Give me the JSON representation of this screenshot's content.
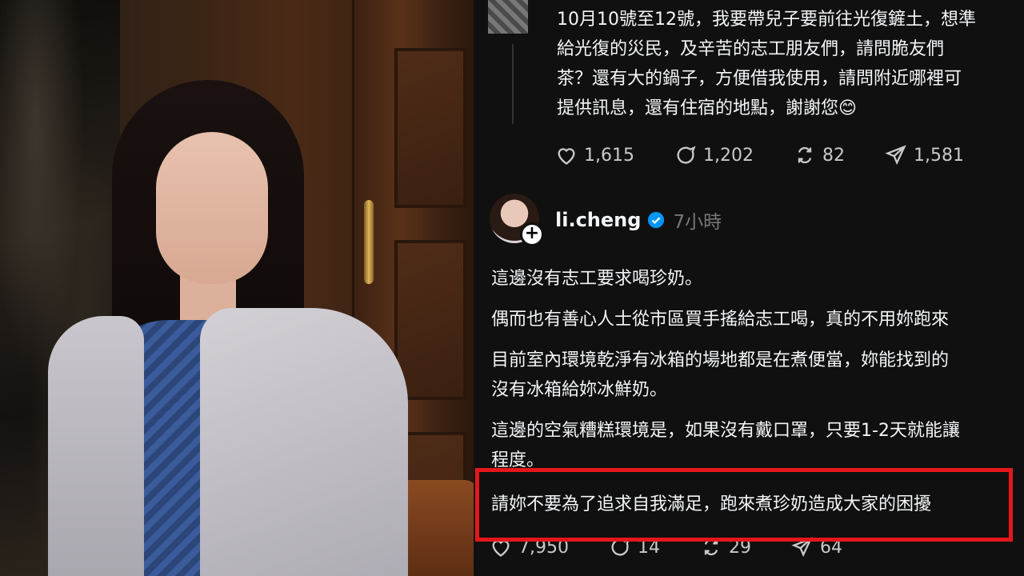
{
  "previous_post": {
    "lines": [
      "10月10號至12號，我要帶兒子要前往光復鏟土，想準",
      "給光復的災民，及辛苦的志工朋友們，請問脆友們",
      "茶？還有大的鍋子，方便借我使用，請問附近哪裡可",
      "提供訊息，還有住宿的地點，謝謝您😊"
    ],
    "stats": {
      "likes": "1,615",
      "comments": "1,202",
      "reposts": "82",
      "shares": "1,581"
    }
  },
  "reply": {
    "username": "li.cheng",
    "time": "7小時",
    "paragraphs": [
      "這邊沒有志工要求喝珍奶。",
      "偶而也有善心人士從市區買手搖給志工喝，真的不用妳跑來",
      "目前室內環境乾淨有冰箱的場地都是在煮便當，妳能找到的",
      "沒有冰箱給妳冰鮮奶。",
      "這邊的空氣糟糕環境是，如果沒有戴口罩，只要1-2天就能讓",
      "程度。",
      "請妳不要為了追求自我滿足，跑來煮珍奶造成大家的困擾"
    ],
    "stats": {
      "likes": "7,950",
      "comments": "14",
      "reposts": "29",
      "shares": "64"
    }
  },
  "colors": {
    "highlight": "#e5171b",
    "verified": "#0095f6",
    "background": "#101010"
  },
  "icons": [
    "heart-icon",
    "comment-icon",
    "repost-icon",
    "share-icon",
    "verified-icon",
    "follow-plus-icon"
  ]
}
